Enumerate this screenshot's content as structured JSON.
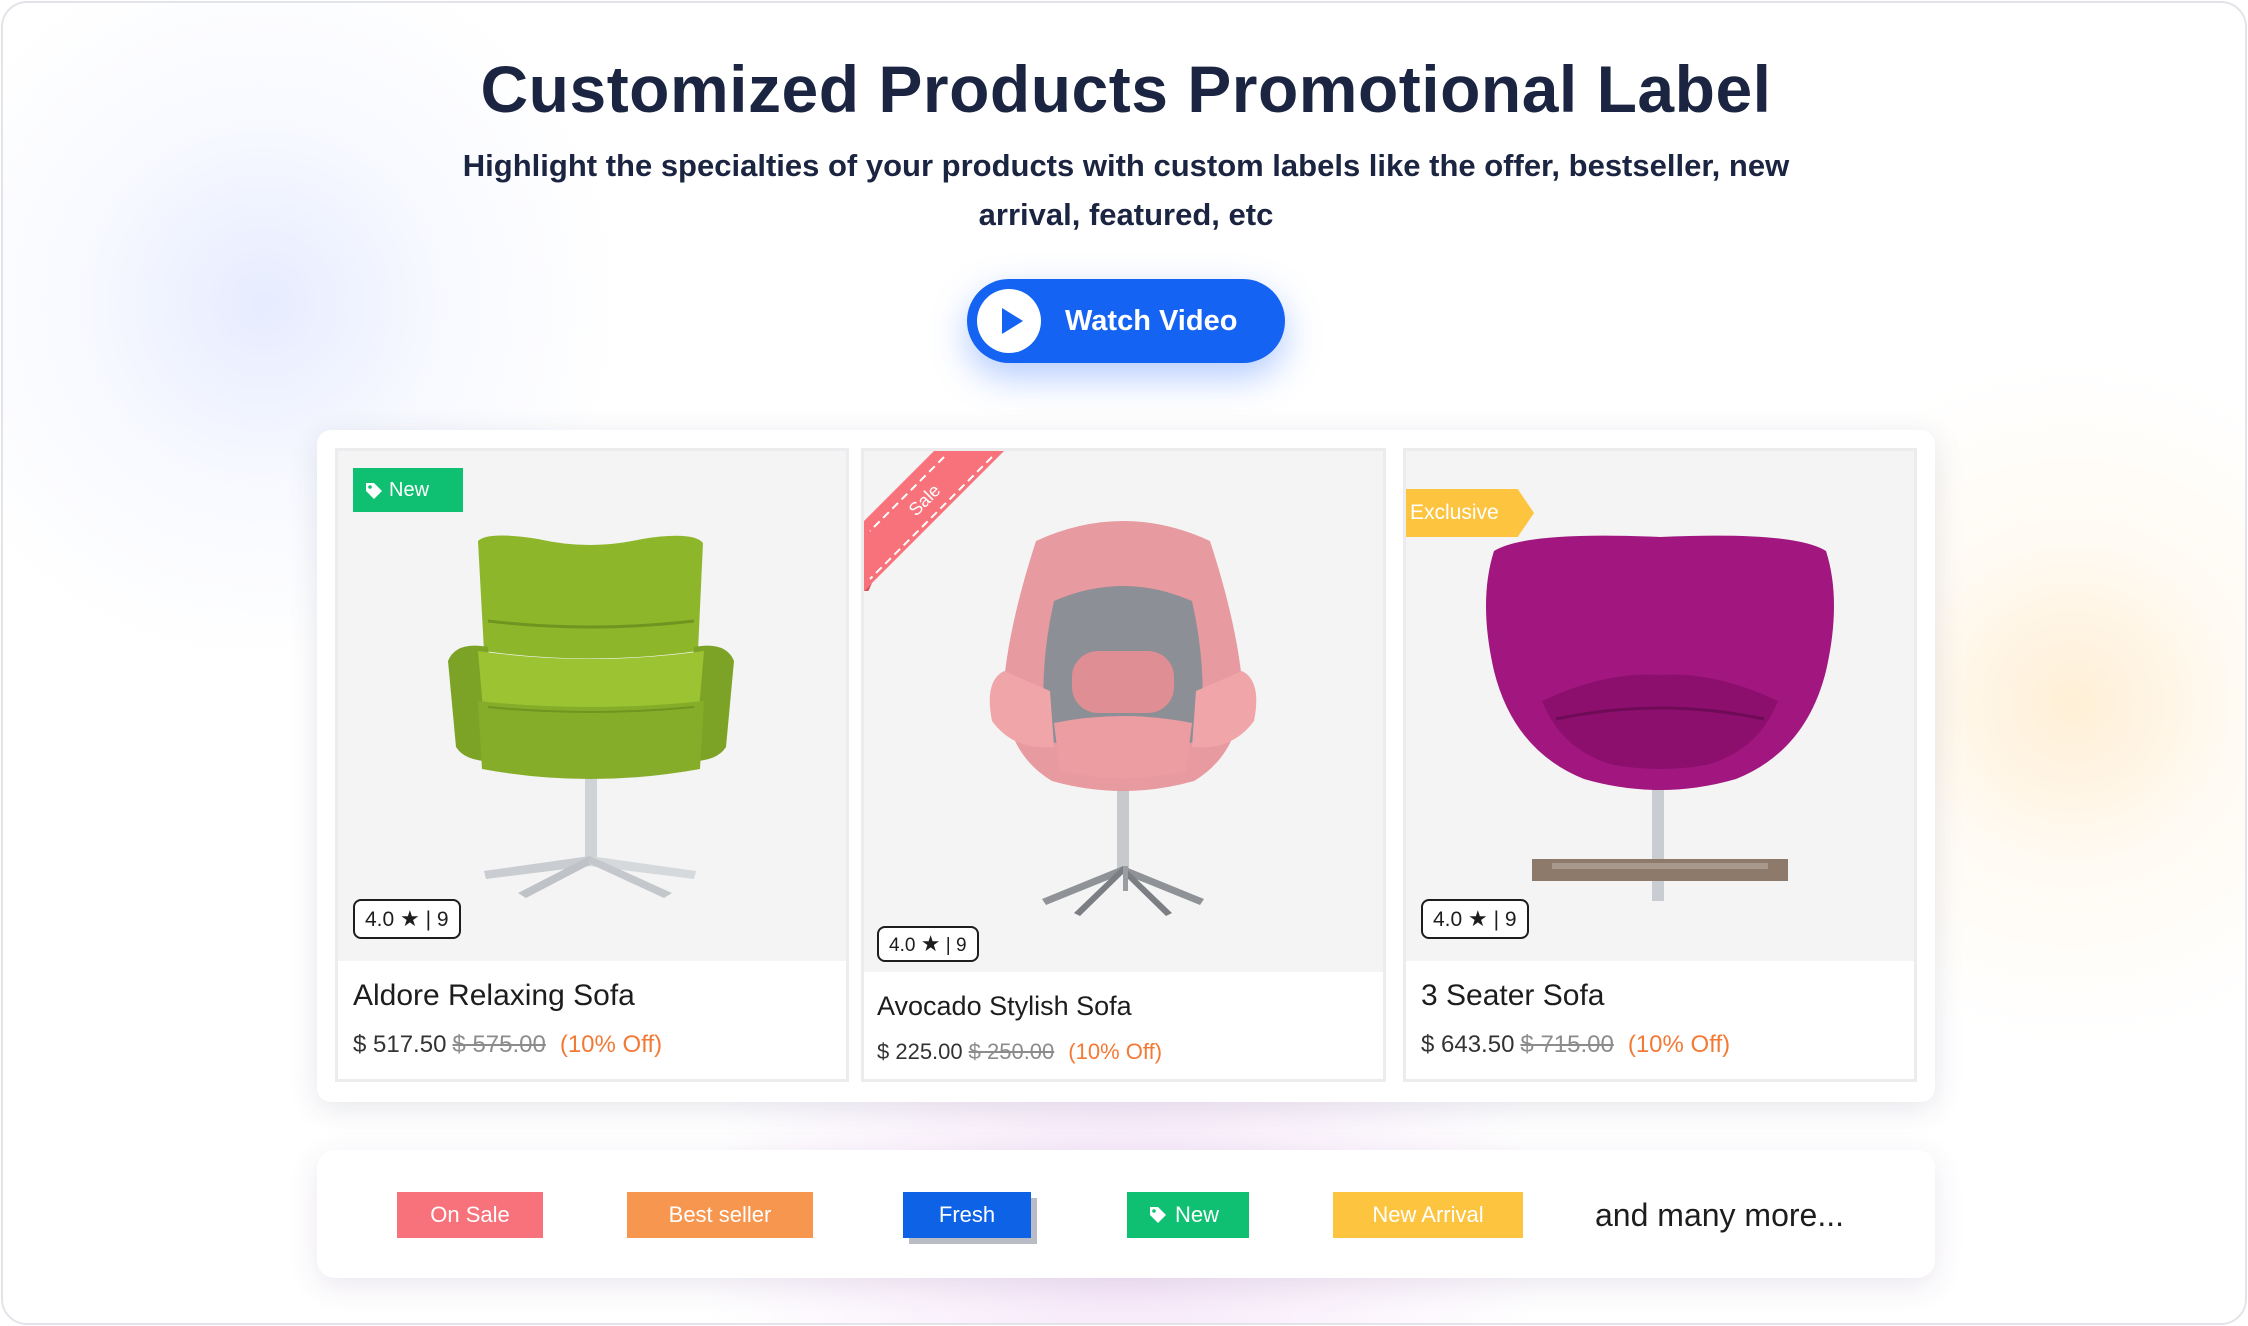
{
  "header": {
    "title": "Customized Products Promotional Label",
    "subtitle": "Highlight the specialties of your products with custom labels like the offer, bestseller, new arrival, featured, etc"
  },
  "cta": {
    "label": "Watch Video",
    "icon": "play-icon",
    "color": "#1463f3"
  },
  "products": [
    {
      "name": "Aldore Relaxing Sofa",
      "price": "$ 517.50",
      "old_price": "$ 575.00",
      "discount": "(10% Off)",
      "rating": "4.0",
      "reviews": "9",
      "label": "New",
      "label_color": "#0fbf72",
      "chair_color": "#8cb52a"
    },
    {
      "name": "Avocado Stylish Sofa",
      "price": "$ 225.00",
      "old_price": "$ 250.00",
      "discount": "(10% Off)",
      "rating": "4.0",
      "reviews": "9",
      "label": "Sale",
      "label_color": "#f7727a",
      "chair_color": "#e79a9f"
    },
    {
      "name": "3 Seater Sofa",
      "price": "$ 643.50",
      "old_price": "$ 715.00",
      "discount": "(10% Off)",
      "rating": "4.0",
      "reviews": "9",
      "label": "Exclusive",
      "label_color": "#fcc43f",
      "chair_color": "#a1177f"
    }
  ],
  "label_examples": [
    {
      "text": "On Sale",
      "color": "#f7727a"
    },
    {
      "text": "Best seller",
      "color": "#f7964f"
    },
    {
      "text": "Fresh",
      "color": "#0d62e6"
    },
    {
      "text": "New",
      "color": "#0fbf72",
      "icon": "tag-icon"
    },
    {
      "text": "New Arrival",
      "color": "#fcc43f"
    }
  ],
  "more_text": "and many more..."
}
